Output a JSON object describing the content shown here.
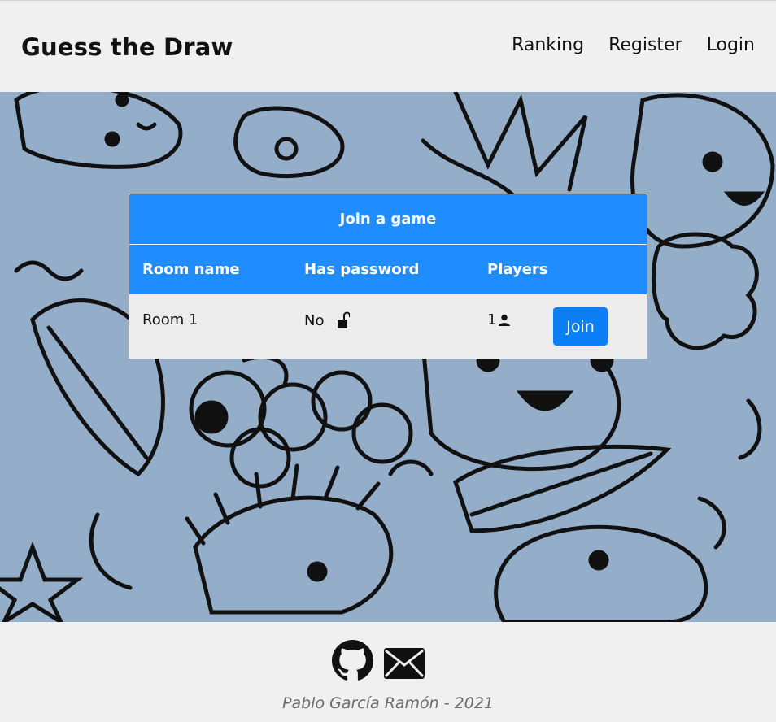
{
  "header": {
    "brand": "Guess the Draw",
    "nav": {
      "ranking": "Ranking",
      "register": "Register",
      "login": "Login"
    }
  },
  "rooms_table": {
    "title": "Join a game",
    "columns": {
      "room_name": "Room name",
      "has_password": "Has password",
      "players": "Players"
    },
    "rows": [
      {
        "room_name": "Room 1",
        "has_password": "No",
        "lock_icon": "unlocked-lock-icon",
        "players": "1",
        "players_icon": "person-icon",
        "join_label": "Join"
      }
    ]
  },
  "footer": {
    "icons": [
      "github-icon",
      "envelope-icon"
    ],
    "copyright": "Pablo García Ramón - 2021"
  },
  "colors": {
    "accent": "#1f8cff",
    "button": "#0d7ff5",
    "hero_bg": "#94aeca",
    "page_bg": "#f0f0f0"
  }
}
